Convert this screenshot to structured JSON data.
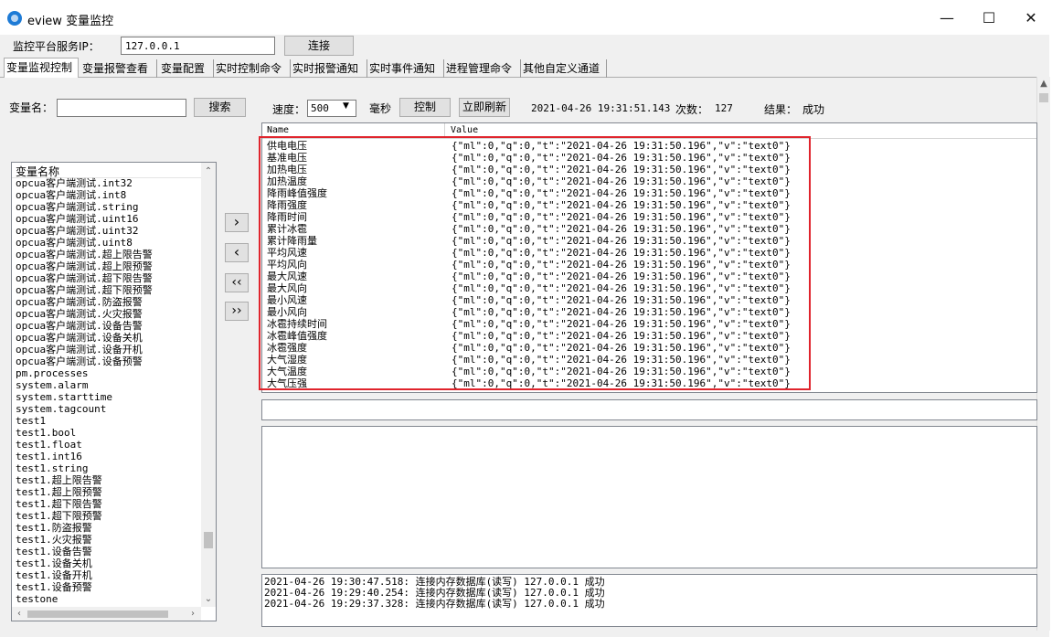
{
  "window": {
    "title": "eview 变量监控",
    "minimize_glyph": "—",
    "maximize_glyph": "☐",
    "close_glyph": "✕"
  },
  "connection": {
    "label": "监控平台服务IP：",
    "ip_value": "127.0.0.1",
    "connect_button": "连接"
  },
  "tabs": [
    {
      "label": "变量监视控制"
    },
    {
      "label": "变量报警查看"
    },
    {
      "label": "变量配置"
    },
    {
      "label": "实时控制命令"
    },
    {
      "label": "实时报警通知"
    },
    {
      "label": "实时事件通知"
    },
    {
      "label": "进程管理命令"
    },
    {
      "label": "其他自定义通道"
    }
  ],
  "search": {
    "label": "变量名：",
    "value": "",
    "button": "搜索"
  },
  "toolbar": {
    "speed_label": "速度：",
    "speed_value": "500",
    "unit_label": "毫秒",
    "control_button": "控制",
    "refresh_button": "立即刷新",
    "timestamp": "2021-04-26 19:31:51.143",
    "count_label": "次数：",
    "count_value": "127",
    "result_label": "结果：",
    "result_value": "成功"
  },
  "variable_list": {
    "header": "变量名称",
    "items": [
      "opcua客户端测试.int32",
      "opcua客户端测试.int8",
      "opcua客户端测试.string",
      "opcua客户端测试.uint16",
      "opcua客户端测试.uint32",
      "opcua客户端测试.uint8",
      "opcua客户端测试.超上限告警",
      "opcua客户端测试.超上限预警",
      "opcua客户端测试.超下限告警",
      "opcua客户端测试.超下限预警",
      "opcua客户端测试.防盗报警",
      "opcua客户端测试.火灾报警",
      "opcua客户端测试.设备告警",
      "opcua客户端测试.设备关机",
      "opcua客户端测试.设备开机",
      "opcua客户端测试.设备预警",
      "pm.processes",
      "system.alarm",
      "system.starttime",
      "system.tagcount",
      "test1",
      "test1.bool",
      "test1.float",
      "test1.int16",
      "test1.string",
      "test1.超上限告警",
      "test1.超上限预警",
      "test1.超下限告警",
      "test1.超下限预警",
      "test1.防盗报警",
      "test1.火灾报警",
      "test1.设备告警",
      "test1.设备关机",
      "test1.设备开机",
      "test1.设备预警",
      "testone"
    ]
  },
  "move_buttons": {
    "add_one": "›",
    "remove_one": "‹",
    "remove_all": "‹‹",
    "add_all": "››"
  },
  "monitor_grid": {
    "col_name": "Name",
    "col_value": "Value",
    "rows": [
      {
        "name": "供电电压",
        "value": "{\"ml\":0,\"q\":0,\"t\":\"2021-04-26 19:31:50.196\",\"v\":\"text0\"}"
      },
      {
        "name": "基准电压",
        "value": "{\"ml\":0,\"q\":0,\"t\":\"2021-04-26 19:31:50.196\",\"v\":\"text0\"}"
      },
      {
        "name": "加热电压",
        "value": "{\"ml\":0,\"q\":0,\"t\":\"2021-04-26 19:31:50.196\",\"v\":\"text0\"}"
      },
      {
        "name": "加热温度",
        "value": "{\"ml\":0,\"q\":0,\"t\":\"2021-04-26 19:31:50.196\",\"v\":\"text0\"}"
      },
      {
        "name": "降雨峰值强度",
        "value": "{\"ml\":0,\"q\":0,\"t\":\"2021-04-26 19:31:50.196\",\"v\":\"text0\"}"
      },
      {
        "name": "降雨强度",
        "value": "{\"ml\":0,\"q\":0,\"t\":\"2021-04-26 19:31:50.196\",\"v\":\"text0\"}"
      },
      {
        "name": "降雨时间",
        "value": "{\"ml\":0,\"q\":0,\"t\":\"2021-04-26 19:31:50.196\",\"v\":\"text0\"}"
      },
      {
        "name": "累计冰雹",
        "value": "{\"ml\":0,\"q\":0,\"t\":\"2021-04-26 19:31:50.196\",\"v\":\"text0\"}"
      },
      {
        "name": "累计降雨量",
        "value": "{\"ml\":0,\"q\":0,\"t\":\"2021-04-26 19:31:50.196\",\"v\":\"text0\"}"
      },
      {
        "name": "平均风速",
        "value": "{\"ml\":0,\"q\":0,\"t\":\"2021-04-26 19:31:50.196\",\"v\":\"text0\"}"
      },
      {
        "name": "平均风向",
        "value": "{\"ml\":0,\"q\":0,\"t\":\"2021-04-26 19:31:50.196\",\"v\":\"text0\"}"
      },
      {
        "name": "最大风速",
        "value": "{\"ml\":0,\"q\":0,\"t\":\"2021-04-26 19:31:50.196\",\"v\":\"text0\"}"
      },
      {
        "name": "最大风向",
        "value": "{\"ml\":0,\"q\":0,\"t\":\"2021-04-26 19:31:50.196\",\"v\":\"text0\"}"
      },
      {
        "name": "最小风速",
        "value": "{\"ml\":0,\"q\":0,\"t\":\"2021-04-26 19:31:50.196\",\"v\":\"text0\"}"
      },
      {
        "name": "最小风向",
        "value": "{\"ml\":0,\"q\":0,\"t\":\"2021-04-26 19:31:50.196\",\"v\":\"text0\"}"
      },
      {
        "name": "冰雹持续时间",
        "value": "{\"ml\":0,\"q\":0,\"t\":\"2021-04-26 19:31:50.196\",\"v\":\"text0\"}"
      },
      {
        "name": "冰雹峰值强度",
        "value": "{\"ml\":0,\"q\":0,\"t\":\"2021-04-26 19:31:50.196\",\"v\":\"text0\"}"
      },
      {
        "name": "冰雹强度",
        "value": "{\"ml\":0,\"q\":0,\"t\":\"2021-04-26 19:31:50.196\",\"v\":\"text0\"}"
      },
      {
        "name": "大气湿度",
        "value": "{\"ml\":0,\"q\":0,\"t\":\"2021-04-26 19:31:50.196\",\"v\":\"text0\"}"
      },
      {
        "name": "大气温度",
        "value": "{\"ml\":0,\"q\":0,\"t\":\"2021-04-26 19:31:50.196\",\"v\":\"text0\"}"
      },
      {
        "name": "大气压强",
        "value": "{\"ml\":0,\"q\":0,\"t\":\"2021-04-26 19:31:50.196\",\"v\":\"text0\"}"
      }
    ]
  },
  "log": {
    "entries": [
      "2021-04-26 19:30:47.518: 连接内存数据库(读写) 127.0.0.1 成功",
      "2021-04-26 19:29:40.254: 连接内存数据库(读写) 127.0.0.1 成功",
      "2021-04-26 19:29:37.328: 连接内存数据库(读写) 127.0.0.1 成功"
    ]
  },
  "colors": {
    "highlight_border": "#e0242c",
    "app_icon": "#1e7bd6"
  }
}
